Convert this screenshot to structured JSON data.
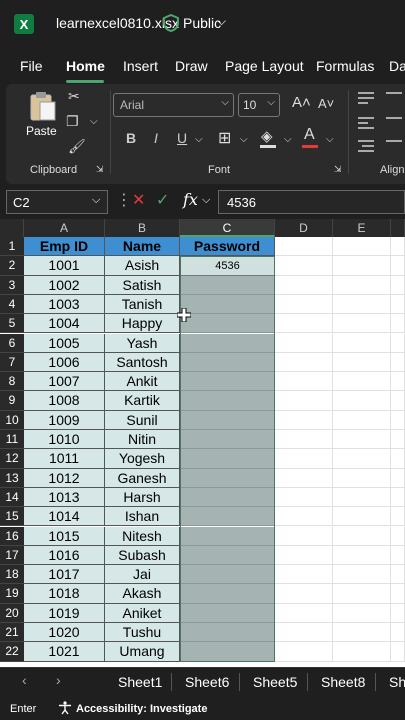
{
  "app": {
    "file_name": "learnexcel0810.xlsx",
    "visibility": "Public",
    "colors": {
      "excel_green": "#107c41",
      "header_blue": "#3d8fd1",
      "data_fill": "#d5e7e6",
      "selected_fill": "#a5b4b3"
    }
  },
  "menu": {
    "tabs": [
      "File",
      "Home",
      "Insert",
      "Draw",
      "Page Layout",
      "Formulas",
      "Da"
    ],
    "active": "Home"
  },
  "ribbon": {
    "clipboard": {
      "paste_label": "Paste",
      "group_label": "Clipboard"
    },
    "font": {
      "font_name": "Arial",
      "font_size": "10",
      "group_label": "Font",
      "bold": "B",
      "italic": "I",
      "underline": "U"
    },
    "alignment": {
      "group_label": "Align"
    }
  },
  "formula_bar": {
    "name_box": "C2",
    "fx": "fx",
    "value": "4536"
  },
  "grid": {
    "columns": [
      "A",
      "B",
      "C",
      "D",
      "E"
    ],
    "selected_column": "C",
    "headers": {
      "a": "Emp ID",
      "b": "Name",
      "c": "Password"
    },
    "active_cell_value": "4536",
    "rows": [
      {
        "n": "1"
      },
      {
        "n": "2",
        "id": "1001",
        "name": "Asish"
      },
      {
        "n": "3",
        "id": "1002",
        "name": "Satish"
      },
      {
        "n": "4",
        "id": "1003",
        "name": "Tanish"
      },
      {
        "n": "5",
        "id": "1004",
        "name": "Happy"
      },
      {
        "n": "6",
        "id": "1005",
        "name": "Yash"
      },
      {
        "n": "7",
        "id": "1006",
        "name": "Santosh"
      },
      {
        "n": "8",
        "id": "1007",
        "name": "Ankit"
      },
      {
        "n": "9",
        "id": "1008",
        "name": "Kartik"
      },
      {
        "n": "10",
        "id": "1009",
        "name": "Sunil"
      },
      {
        "n": "11",
        "id": "1010",
        "name": "Nitin"
      },
      {
        "n": "12",
        "id": "1011",
        "name": "Yogesh"
      },
      {
        "n": "13",
        "id": "1012",
        "name": "Ganesh"
      },
      {
        "n": "14",
        "id": "1013",
        "name": "Harsh"
      },
      {
        "n": "15",
        "id": "1014",
        "name": "Ishan"
      },
      {
        "n": "16",
        "id": "1015",
        "name": "Nitesh"
      },
      {
        "n": "17",
        "id": "1016",
        "name": "Subash"
      },
      {
        "n": "18",
        "id": "1017",
        "name": "Jai"
      },
      {
        "n": "19",
        "id": "1018",
        "name": "Akash"
      },
      {
        "n": "20",
        "id": "1019",
        "name": "Aniket"
      },
      {
        "n": "21",
        "id": "1020",
        "name": "Tushu"
      },
      {
        "n": "22",
        "id": "1021",
        "name": "Umang"
      }
    ]
  },
  "sheets": {
    "tabs": [
      "Sheet1",
      "Sheet6",
      "Sheet5",
      "Sheet8",
      "Sh"
    ]
  },
  "status": {
    "mode": "Enter",
    "accessibility": "Accessibility: Investigate"
  }
}
